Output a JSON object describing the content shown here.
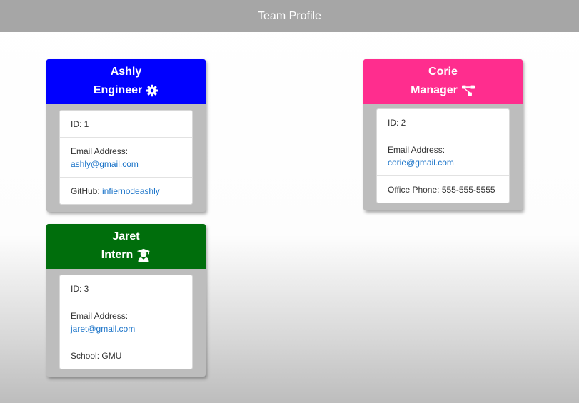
{
  "header": {
    "title": "Team Profile"
  },
  "colors": {
    "engineer": "#0000ff",
    "manager": "#ff2d8e",
    "intern": "#006e0c",
    "header_bar": "#a6a6a6",
    "link": "#1a73c8"
  },
  "cards": [
    {
      "name": "Ashly",
      "role": "Engineer",
      "icon": "gear-icon",
      "id_text": "ID: 1",
      "email_label": "Email Address:",
      "email": "ashly@gmail.com",
      "extra_label": "GitHub: ",
      "extra_value": "infiernodeashly"
    },
    {
      "name": "Corie",
      "role": "Manager",
      "icon": "sitemap-icon",
      "id_text": "ID: 2",
      "email_label": "Email Address:",
      "email": "corie@gmail.com",
      "extra_label": "Office Phone: 555-555-5555"
    },
    {
      "name": "Jaret",
      "role": "Intern",
      "icon": "graduate-icon",
      "id_text": "ID: 3",
      "email_label": "Email Address:",
      "email": "jaret@gmail.com",
      "extra_label": "School: GMU"
    }
  ]
}
